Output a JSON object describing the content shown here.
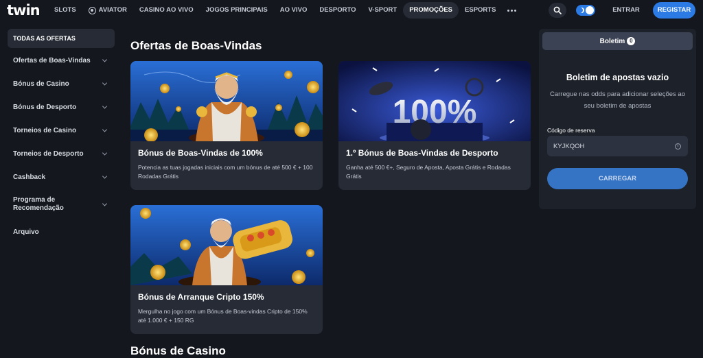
{
  "header": {
    "logo": "twin",
    "nav": [
      {
        "label": "SLOTS"
      },
      {
        "label": "AVIATOR",
        "icon": "aviator-icon"
      },
      {
        "label": "CASINO AO VIVO"
      },
      {
        "label": "JOGOS PRINCIPAIS"
      },
      {
        "label": "AO VIVO"
      },
      {
        "label": "DESPORTO"
      },
      {
        "label": "V-SPORT"
      },
      {
        "label": "PROMOÇÕES",
        "active": true
      },
      {
        "label": "ESPORTS"
      }
    ],
    "login_label": "ENTRAR",
    "register_label": "REGISTAR"
  },
  "sidebar": {
    "items": [
      {
        "label": "TODAS AS OFERTAS",
        "active": true
      },
      {
        "label": "Ofertas de Boas-Vindas"
      },
      {
        "label": "Bónus de Casino"
      },
      {
        "label": "Bónus de Desporto"
      },
      {
        "label": "Torneios de Casino"
      },
      {
        "label": "Torneios de Desporto"
      },
      {
        "label": "Cashback"
      },
      {
        "label": "Programa de Recomendação"
      },
      {
        "label": "Arquivo"
      }
    ]
  },
  "main": {
    "section_title": "Ofertas de Boas-Vindas",
    "next_section_title": "Bónus de Casino",
    "cards": [
      {
        "title": "Bónus de Boas-Vindas de 100%",
        "desc": "Potencia as tuas jogadas iniciais com um bónus de até 500 € + 100 Rodadas Grátis"
      },
      {
        "title": "1.º Bónus de Boas-Vindas de Desporto",
        "desc": "Ganha até 500 €+, Seguro de Aposta, Aposta Grátis e Rodadas Grátis",
        "image_text": "100%"
      },
      {
        "title": "Bónus de Arranque Cripto 150%",
        "desc": "Mergulha no jogo com um Bónus de Boas-vindas Cripto de 150% até 1.000 € + 150 RG"
      }
    ]
  },
  "betslip": {
    "tab_label": "Boletim",
    "count": "0",
    "empty_title": "Boletim de apostas vazio",
    "empty_desc": "Carregue nas odds para adicionar seleções ao seu boletim de apostas",
    "code_label": "Código de reserva",
    "code_value": "KYJKQOH",
    "load_label": "CARREGAR"
  },
  "colors": {
    "background": "#14171e",
    "card": "#262b36",
    "accent": "#2c7be5"
  }
}
